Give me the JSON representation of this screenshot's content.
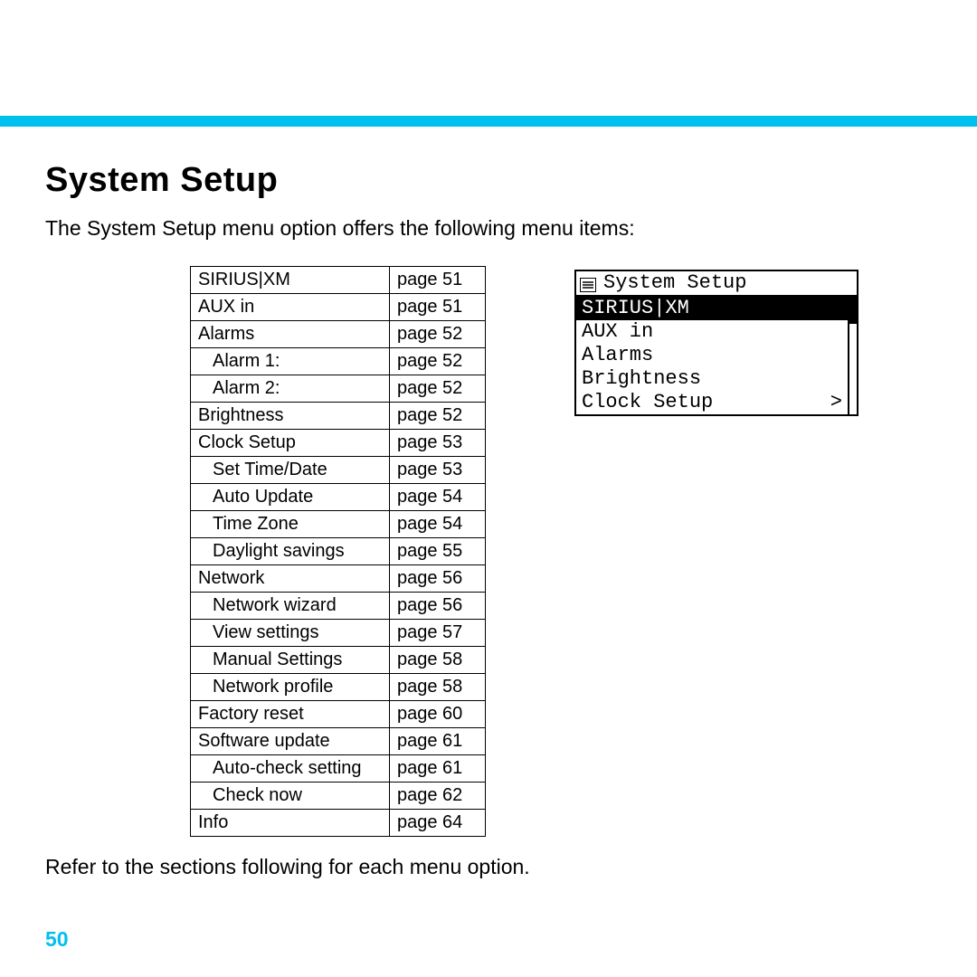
{
  "title": "System Setup",
  "intro": "The System Setup menu option offers the following menu items:",
  "outro": "Refer to the sections following for each menu option.",
  "pageNumber": "50",
  "table": [
    {
      "label": "SIRIUS|XM",
      "page": "page 51",
      "indent": 0
    },
    {
      "label": "AUX in",
      "page": "page 51",
      "indent": 0
    },
    {
      "label": "Alarms",
      "page": "page 52",
      "indent": 0
    },
    {
      "label": "Alarm 1:",
      "page": "page 52",
      "indent": 1
    },
    {
      "label": "Alarm 2:",
      "page": "page 52",
      "indent": 1
    },
    {
      "label": "Brightness",
      "page": "page 52",
      "indent": 0
    },
    {
      "label": "Clock Setup",
      "page": "page 53",
      "indent": 0
    },
    {
      "label": "Set Time/Date",
      "page": "page 53",
      "indent": 1
    },
    {
      "label": "Auto Update",
      "page": "page 54",
      "indent": 1
    },
    {
      "label": "Time Zone",
      "page": "page 54",
      "indent": 1
    },
    {
      "label": "Daylight savings",
      "page": "page 55",
      "indent": 1
    },
    {
      "label": "Network",
      "page": "page 56",
      "indent": 0
    },
    {
      "label": "Network wizard",
      "page": "page 56",
      "indent": 1
    },
    {
      "label": "View settings",
      "page": "page 57",
      "indent": 1
    },
    {
      "label": "Manual Settings",
      "page": "page 58",
      "indent": 1
    },
    {
      "label": "Network profile",
      "page": "page 58",
      "indent": 1
    },
    {
      "label": "Factory reset",
      "page": "page 60",
      "indent": 0
    },
    {
      "label": "Software update",
      "page": "page 61",
      "indent": 0
    },
    {
      "label": "Auto-check setting",
      "page": "page 61",
      "indent": 1
    },
    {
      "label": "Check now",
      "page": "page 62",
      "indent": 1
    },
    {
      "label": "Info",
      "page": "page 64",
      "indent": 0
    }
  ],
  "lcd": {
    "header": "System Setup",
    "items": [
      {
        "label": "SIRIUS|XM",
        "suffix": "",
        "selected": true
      },
      {
        "label": "AUX in",
        "suffix": "",
        "selected": false
      },
      {
        "label": "Alarms",
        "suffix": "",
        "selected": false
      },
      {
        "label": "Brightness",
        "suffix": "",
        "selected": false
      },
      {
        "label": "Clock Setup",
        "suffix": ">",
        "selected": false
      }
    ]
  }
}
